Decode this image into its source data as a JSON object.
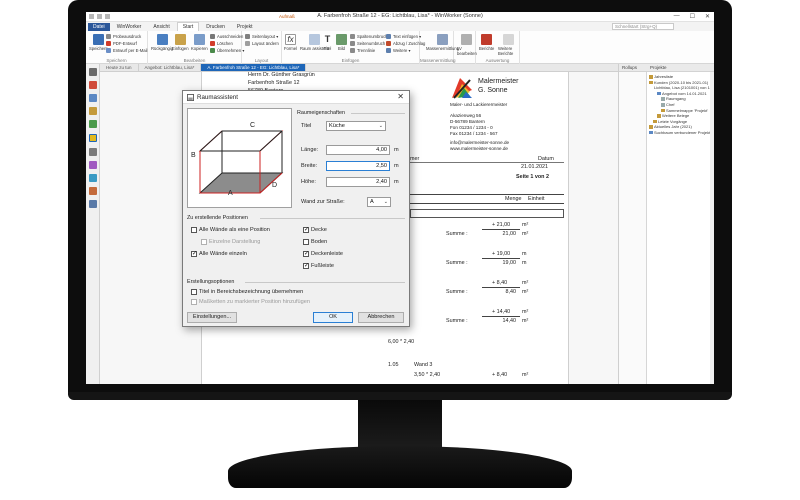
{
  "window": {
    "title": "A. Farbenfroh Straße 12 - EG: Lichtblau, Lisa* - WinWorker (Sonne)",
    "controls": [
      "—",
      "☐",
      "✕"
    ]
  },
  "ribbon_tabs": {
    "context_group": "Aufmaß",
    "tabs": [
      "Datei",
      "WinWorker",
      "Ansicht",
      "Start",
      "Drucken",
      "Projekt"
    ],
    "active": "Start",
    "search_placeholder": "Schnellstart (Strg+Q)"
  },
  "ribbon": {
    "speichern": {
      "label": "Speichern",
      "items": [
        "Probeausdruck",
        "PDF-Entwurf",
        "Entwurf per E-Mail"
      ],
      "group": "Speichern"
    },
    "bearbeiten": {
      "undo": "Rückgängig",
      "paste": "Einfügen",
      "copy": "Kopieren",
      "items": [
        "Ausschneiden",
        "Löschen",
        "Übernehmen ▾"
      ],
      "group": "Bearbeiten"
    },
    "layout": {
      "items": [
        "Seitenlayout ▾",
        "Layout ändern"
      ],
      "group": "Layout"
    },
    "einfuegen": {
      "buttons": [
        "Formel",
        "Raum assistent",
        "Titel",
        "Bild"
      ],
      "items": [
        "Spaltenumbruch",
        "Seitenumbruch",
        "Trennlinie"
      ],
      "items2": [
        "Text einfügen ▾",
        "Abzug / Zuschlag",
        "Weitere ▾"
      ],
      "group": "Einfügen"
    },
    "massenermittlung": {
      "button": "Massenermittlung",
      "group": "Massenermittlung"
    },
    "uebernahme": {
      "buttons": [
        "LV bearbeiten"
      ],
      "group": ""
    },
    "auswertung": {
      "buttons": [
        "Berichte",
        "Weitere Berichte"
      ],
      "group": "Auswertung"
    }
  },
  "doc_tabs": [
    "Heute zu tun",
    "Angebot: Lichtblau, Lisa*",
    "A. Farbenfroh Straße 12 - EG: Lichtblau, Lisa*"
  ],
  "document": {
    "address": [
      "Herrn Dr. Günther Grasgrün",
      "Farbenfroh Straße 12",
      "56789 Bantern"
    ],
    "company": {
      "name_line1": "Malermeister",
      "name_line2": "G. Sonne",
      "tagline": "Maler- und Lackierermeister"
    },
    "company_address": [
      "Akazienweg 56",
      "D-56789 Bantern",
      "Fon 01234 / 1234 - 0",
      "Fax 01234 / 1234 - 567"
    ],
    "company_web": [
      "info@malermeister-sonne.de",
      "www.malermeister-sonne.de"
    ],
    "header_right": {
      "datum_label": "Datum",
      "datum": "21.01.2021",
      "seite": "Seite 1 von 2"
    },
    "columns": {
      "menge": "Menge",
      "einheit": "Einheit"
    },
    "left_cut": "mer",
    "rows": [
      {
        "value": "+ 21,00",
        "unit": "m²",
        "sum_label": "Summe :",
        "sum": "21,00",
        "sum_unit": "m²"
      },
      {
        "value": "+ 19,00",
        "unit": "m",
        "sum_label": "Summe :",
        "sum": "19,00",
        "sum_unit": "m"
      },
      {
        "value": "+ 8,40",
        "unit": "m²",
        "sum_label": "Summe :",
        "sum": "8,40",
        "sum_unit": "m²"
      },
      {
        "value": "+ 14,40",
        "unit": "m²",
        "sum_label": "Summe :",
        "sum": "14,40",
        "sum_unit": "m²"
      }
    ],
    "formula": "6,00 * 2,40",
    "position": {
      "number": "1.05",
      "text": "Wand 3"
    },
    "bottom_formula": "3,50 * 2,40",
    "bottom_value": "+ 8,40",
    "bottom_unit": "m²"
  },
  "right_panel": {
    "header_left": "Rollups",
    "header_right": "Projekte",
    "tree": [
      "Jahresliste",
      "Kunden (2020-10 bis 2021-01)",
      "Lichtblau, Lisa (2101001) von 14.1",
      "Angebot vom 14.01.2021",
      "Raumgang",
      "Chef",
      "Sammelmappe 'Projekt'",
      "Weitere Belege",
      "Letzte Vorgänge",
      "Aktuelles Jahr (2021)",
      "Suchbaum verbundener Projekte"
    ]
  },
  "dialog": {
    "title": "Raumassistent",
    "room_props_label": "Raumeigenschaften",
    "titel_label": "Titel",
    "titel_value": "Küche",
    "laenge_label": "Länge:",
    "laenge_value": "4,00",
    "breite_label": "Breite:",
    "breite_value": "2,50",
    "hoehe_label": "Höhe:",
    "hoehe_value": "2,40",
    "unit_m": "m",
    "wand_label": "Wand zur Straße:",
    "wand_value": "A",
    "diagram_labels": {
      "a": "A",
      "b": "B",
      "c": "C",
      "d": "D"
    },
    "positions_label": "Zu erstellende Positionen",
    "checkboxes_left": [
      {
        "label": "Alle Wände als eine Position",
        "checked": false,
        "disabled": false
      },
      {
        "label": "Einzelne Darstellung",
        "checked": false,
        "disabled": true
      },
      {
        "label": "Alle Wände einzeln",
        "checked": true,
        "disabled": false
      }
    ],
    "checkboxes_right": [
      {
        "label": "Decke",
        "checked": true
      },
      {
        "label": "Boden",
        "checked": false
      },
      {
        "label": "Deckenleiste",
        "checked": true
      },
      {
        "label": "Fußleiste",
        "checked": true
      }
    ],
    "options_label": "Erstellungsoptionen",
    "options": [
      {
        "label": "Titel in Bereichsbezeichnung übernehmen",
        "checked": false,
        "disabled": false
      },
      {
        "label": "Maßketten zu markierter Position hinzufügen",
        "checked": false,
        "disabled": true
      }
    ],
    "buttons": {
      "settings": "Einstellungen...",
      "ok": "OK",
      "cancel": "Abbrechen"
    },
    "close": "✕"
  },
  "colors": {
    "accent": "#2b579a",
    "active_tab": "#1e66b8",
    "room_edge": "#cc2222",
    "floor": "#8c8c8c"
  }
}
